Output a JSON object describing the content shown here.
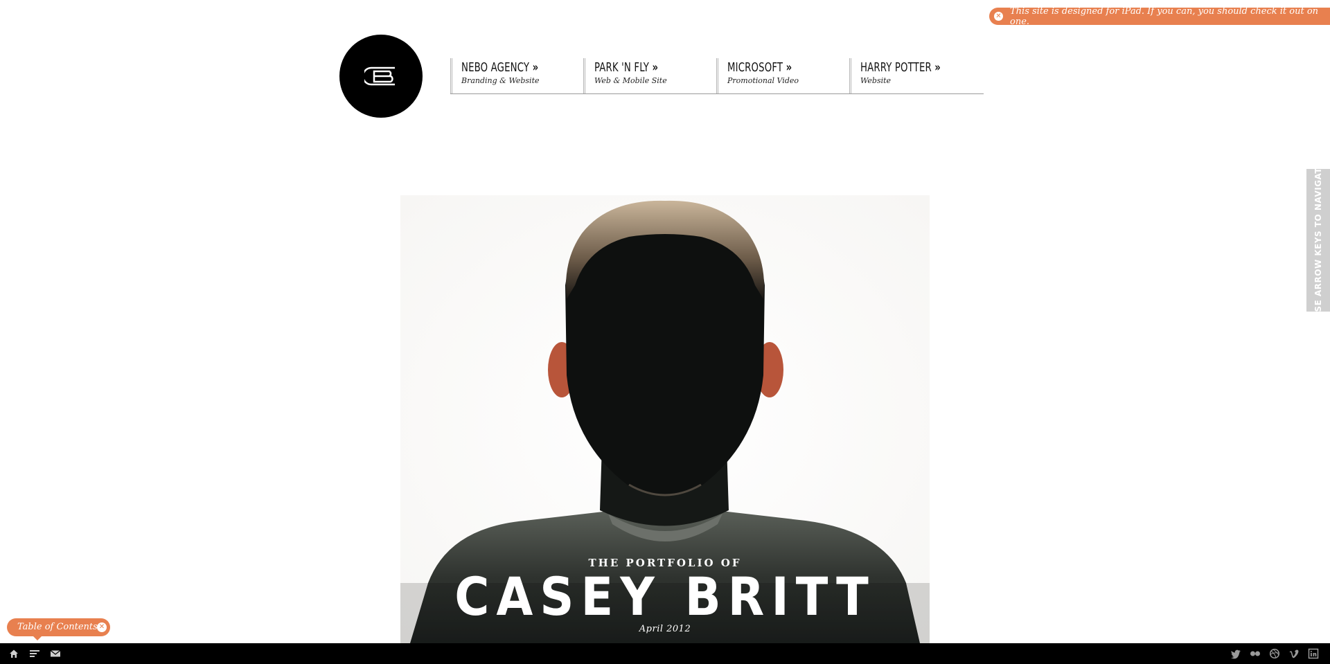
{
  "notice": {
    "text": "This site is designed for iPad. If you can, you should check it out on one.",
    "close_icon": "close-circle-icon"
  },
  "logo": {
    "icon": "cb-monogram-icon"
  },
  "nav": [
    {
      "title": "NEBO AGENCY",
      "arrow": "»",
      "subtitle": "Branding & Website"
    },
    {
      "title": "PARK 'N FLY",
      "arrow": "»",
      "subtitle": "Web & Mobile Site"
    },
    {
      "title": "MICROSOFT",
      "arrow": "»",
      "subtitle": "Promotional Video"
    },
    {
      "title": "HARRY POTTER",
      "arrow": "»",
      "subtitle": "Website"
    }
  ],
  "side_tab": {
    "label": "USE ARROW KEYS TO NAVIGATE"
  },
  "hero": {
    "eyebrow": "THE PORTFOLIO OF",
    "name": "CASEY BRITT",
    "date": "April 2012"
  },
  "toc": {
    "label": "Table of Contents",
    "close_icon": "close-circle-icon"
  },
  "bottom_bar": {
    "left_icons": [
      "home-icon",
      "menu-icon",
      "mail-icon"
    ],
    "right_icons": [
      "twitter-icon",
      "flickr-icon",
      "dribbble-icon",
      "vimeo-icon",
      "linkedin-icon"
    ]
  },
  "colors": {
    "accent": "#e8804f",
    "bar": "#000000",
    "text": "#141414"
  }
}
